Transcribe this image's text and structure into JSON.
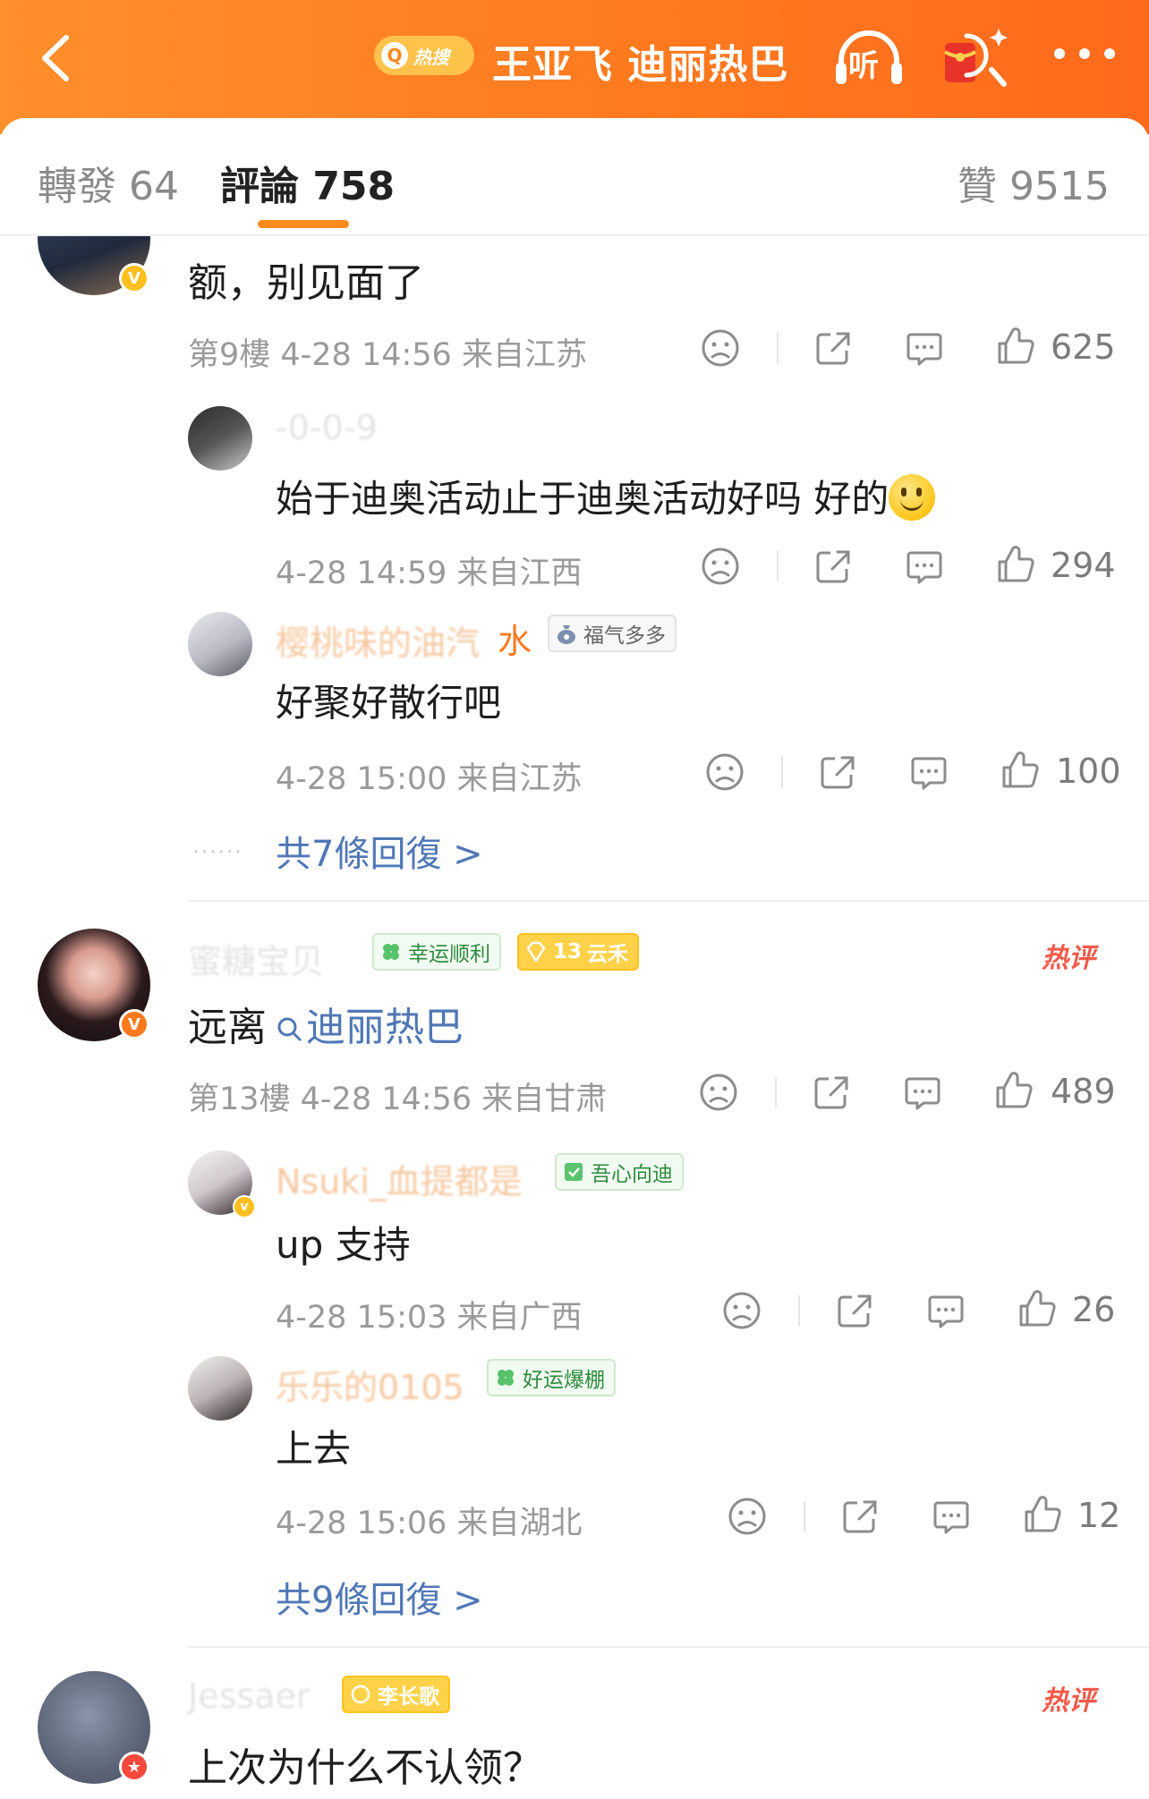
{
  "header": {
    "hot_search_label": "热搜",
    "title": "王亚飞 迪丽热巴",
    "listen_label": "听"
  },
  "tabs": {
    "repost": "轉發 64",
    "comments": "評論 758",
    "likes": "贊 9515"
  },
  "comments": [
    {
      "text": "额，别见面了",
      "floor_meta": "第9樓 4-28 14:56 来自江苏",
      "likes": "625",
      "replies": [
        {
          "username": "-0-0-9",
          "text": "始于迪奥活动止于迪奥活动好吗 好的",
          "meta": "4-28 14:59 来自江西",
          "likes": "294"
        },
        {
          "username": "樱桃味的油汽",
          "username_tail": "水",
          "badge": "福气多多",
          "text": "好聚好散行吧",
          "meta": "4-28 15:00 来自江苏",
          "likes": "100"
        }
      ],
      "more_replies": "共7條回復 >",
      "dots": "......"
    },
    {
      "username": "蜜糖宝贝",
      "badges": [
        "幸运顺利",
        "13",
        "云禾"
      ],
      "hot_label": "热评",
      "text_prefix": "远离",
      "link_text": "迪丽热巴",
      "floor_meta": "第13樓 4-28 14:56 来自甘肃",
      "likes": "489",
      "replies": [
        {
          "username": "Nsuki_血提都是",
          "badge": "吾心向迪",
          "text": "up 支持",
          "meta": "4-28 15:03 来自广西",
          "likes": "26"
        },
        {
          "username": "乐乐的0105",
          "badge": "好运爆棚",
          "text": "上去",
          "meta": "4-28 15:06 来自湖北",
          "likes": "12"
        }
      ],
      "more_replies": "共9條回復 >"
    },
    {
      "username": "Jessaer",
      "badge": "李长歌",
      "hot_label": "热评",
      "text": "上次为什么不认领？"
    }
  ],
  "colors": {
    "brand_orange": "#ff7a1f",
    "link_blue": "#5077b5",
    "hot_red": "#f25a4a"
  },
  "icons": [
    "back-arrow-icon",
    "search-icon",
    "headphones-icon",
    "red-packet-icon",
    "more-dots-icon",
    "dislike-face-icon",
    "share-icon",
    "comment-icon",
    "thumbs-up-icon"
  ]
}
